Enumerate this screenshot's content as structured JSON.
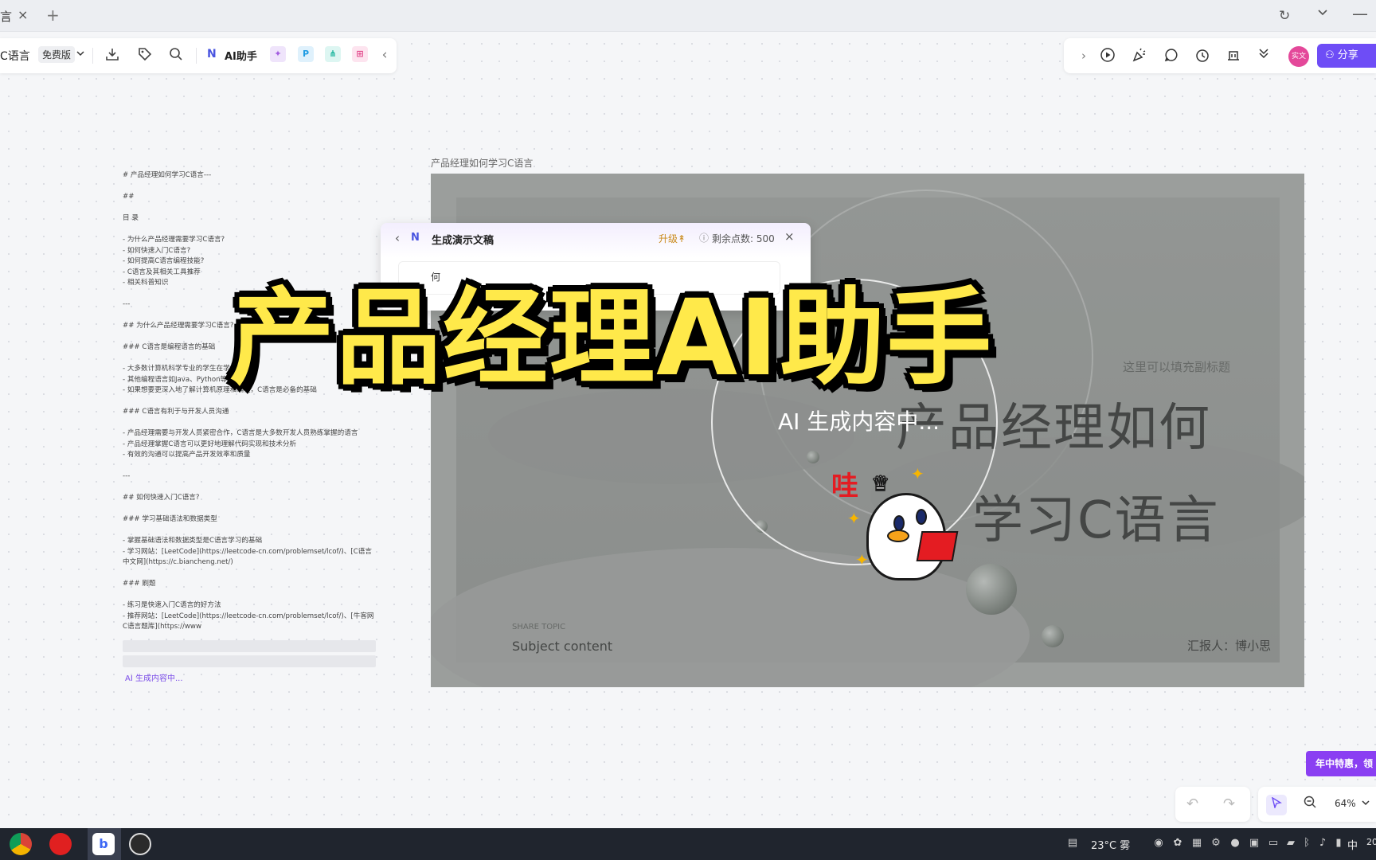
{
  "browser": {
    "tab_fragment": "言",
    "tab_close_icon": "×",
    "new_tab_icon": "+",
    "refresh_icon": "↻",
    "tab_list_icon": "⌄",
    "minimize_icon": "—"
  },
  "toolbar_left": {
    "doc_title": "C语言",
    "plan_badge": "免费版",
    "ai_logo": "N",
    "ai_label": "AI助手",
    "collapse_icon": "‹"
  },
  "toolbar_right": {
    "avatar_text": "实文",
    "share_label": "分享"
  },
  "outline": {
    "lines": [
      "# 产品经理如何学习C语言---",
      "",
      "##",
      "",
      "目 录",
      "",
      "- 为什么产品经理需要学习C语言?",
      "- 如何快速入门C语言?",
      "- 如何提高C语言编程技能?",
      "- C语言及其相关工具推荐",
      "- 相关科普知识",
      "",
      "---",
      "",
      "## 为什么产品经理需要学习C语言?",
      "",
      "### C语言是编程语言的基础",
      "",
      "- 大多数计算机科学专业的学生在学",
      "- 其他编程语言如Java、Python等都",
      "- 如果想要更深入地了解计算机原理和编程，C语言是必备的基础",
      "",
      "### C语言有利于与开发人员沟通",
      "",
      "- 产品经理需要与开发人员紧密合作，C语言是大多数开发人员熟练掌握的语言",
      "- 产品经理掌握C语言可以更好地理解代码实现和技术分析",
      "- 有效的沟通可以提高产品开发效率和质量",
      "",
      "---",
      "",
      "## 如何快速入门C语言?",
      "",
      "### 学习基础语法和数据类型",
      "",
      "- 掌握基础语法和数据类型是C语言学习的基础",
      "- 学习网站：[LeetCode](https://leetcode-cn.com/problemset/lcof/)、[C语言",
      "中文网](https://c.biancheng.net/)",
      "",
      "### 刷题",
      "",
      "- 练习是快速入门C语言的好方法",
      "- 推荐网站：[LeetCode](https://leetcode-cn.com/problemset/lcof/)、[牛客网",
      "C语言题库](https://www"
    ],
    "generating_label": "AI 生成内容中..."
  },
  "slide": {
    "caption": "产品经理如何学习C语言",
    "subtitle_placeholder": "这里可以填充副标题",
    "title_line1": "产品经理如何",
    "title_line2": "学习C语言",
    "share_topic": "SHARE TOPIC",
    "subject": "Subject content",
    "reporter": "汇报人：博小思",
    "generating_text": "AI 生成内容中..."
  },
  "gen_panel": {
    "back_icon": "‹",
    "logo": "N",
    "title": "生成演示文稿",
    "upgrade_label": "升级",
    "upgrade_icon": "↟",
    "info_icon": "ⓘ",
    "points_label": "剩余点数: 500",
    "close_icon": "×",
    "input_value": "何"
  },
  "banner_text": "产品经理AI助手",
  "sticker_text": "哇",
  "promo_label": "年中特惠，领",
  "zoom": {
    "level": "64%"
  },
  "taskbar": {
    "weather": "23°C 雾",
    "ime": "中",
    "clock_fragment": "20"
  }
}
